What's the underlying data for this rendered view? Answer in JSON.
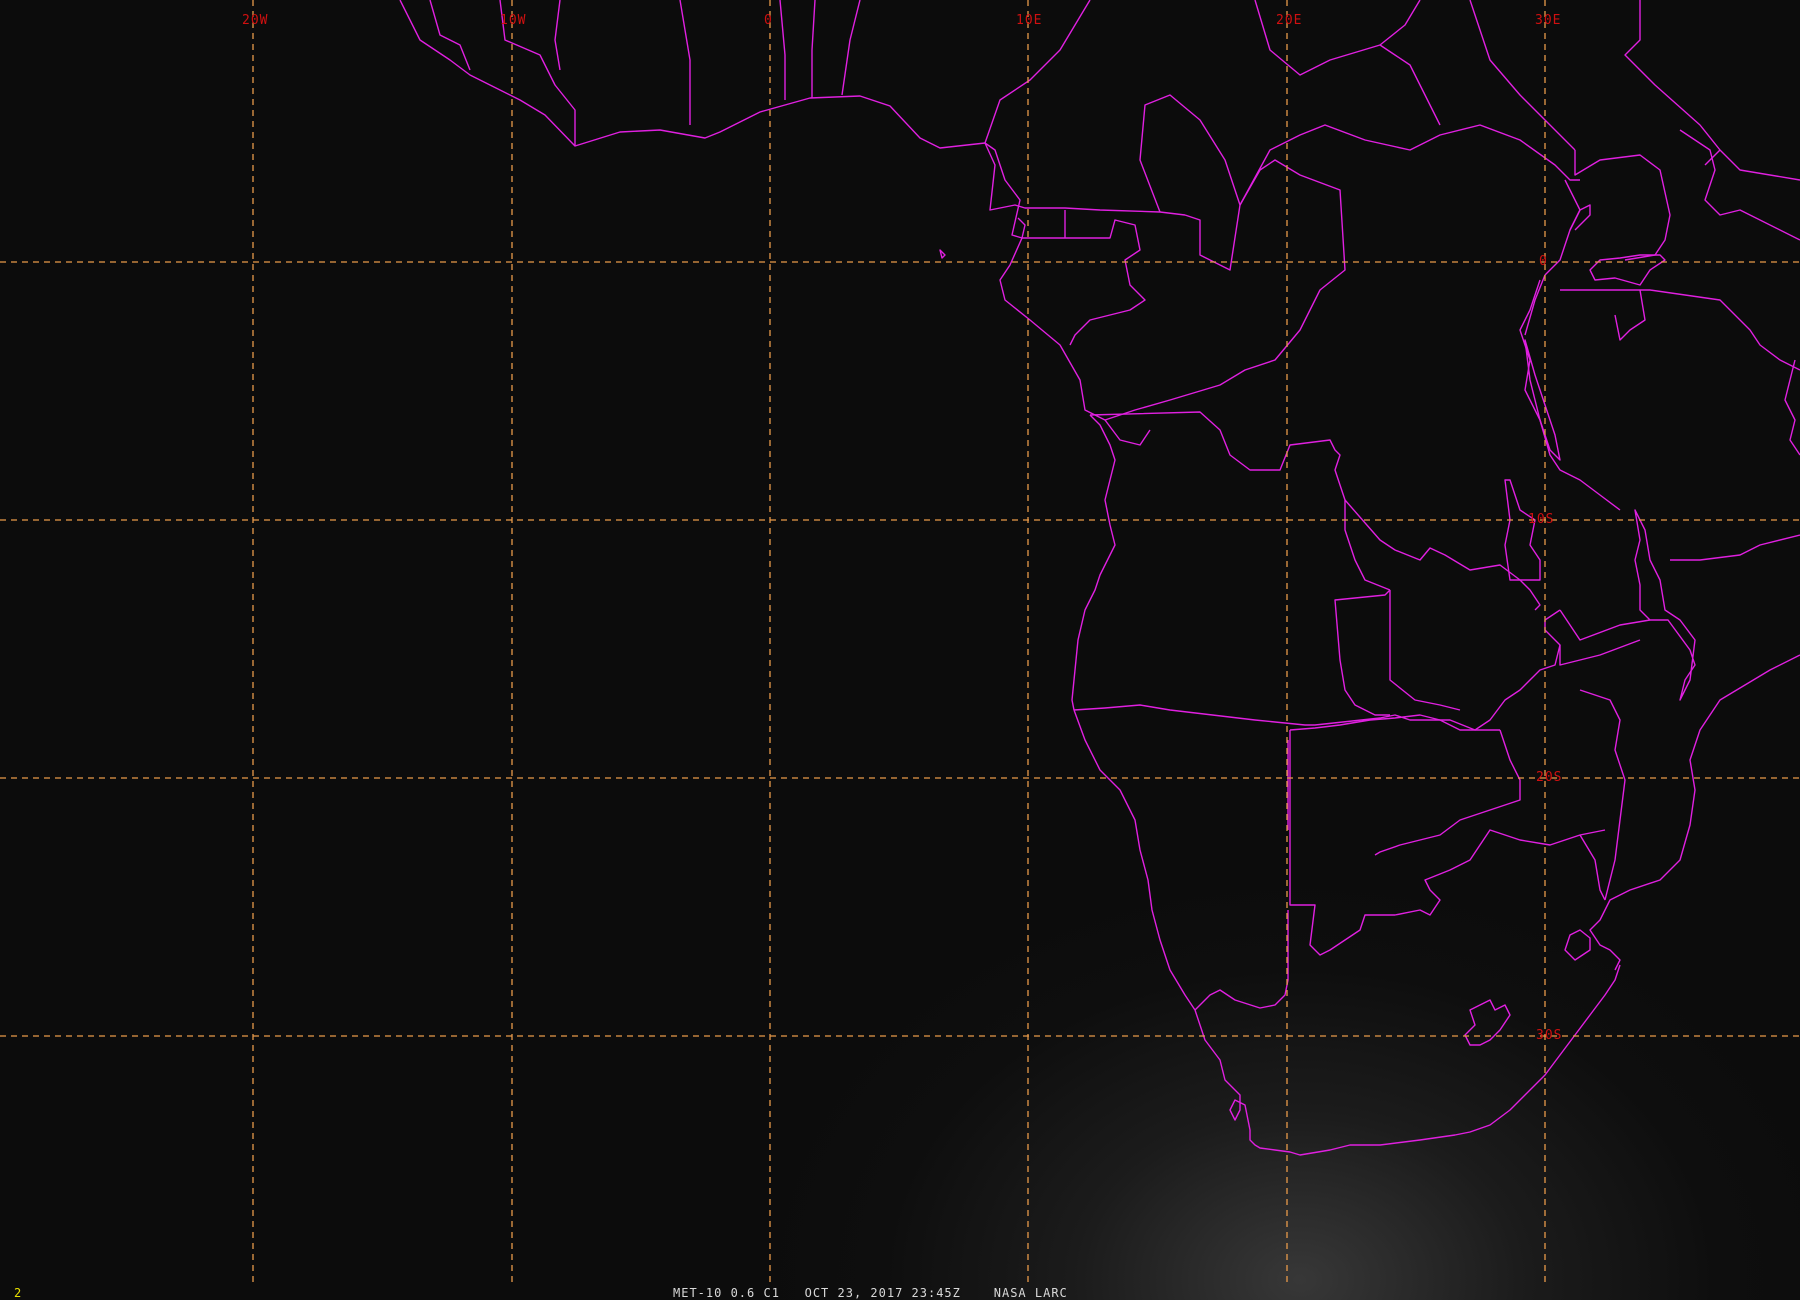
{
  "map": {
    "grid_color": "#e89a4a",
    "border_color": "#e020e0",
    "label_color": "#d01010",
    "longitude_labels": [
      "20W",
      "10W",
      "0",
      "10E",
      "20E",
      "30E"
    ],
    "latitude_labels": [
      "0",
      "10S",
      "20S",
      "30S"
    ]
  },
  "status_bar": {
    "frame_number": "2",
    "text": "MET-10 0.6 C1   OCT 23, 2017 23:45Z    NASA LARC"
  }
}
